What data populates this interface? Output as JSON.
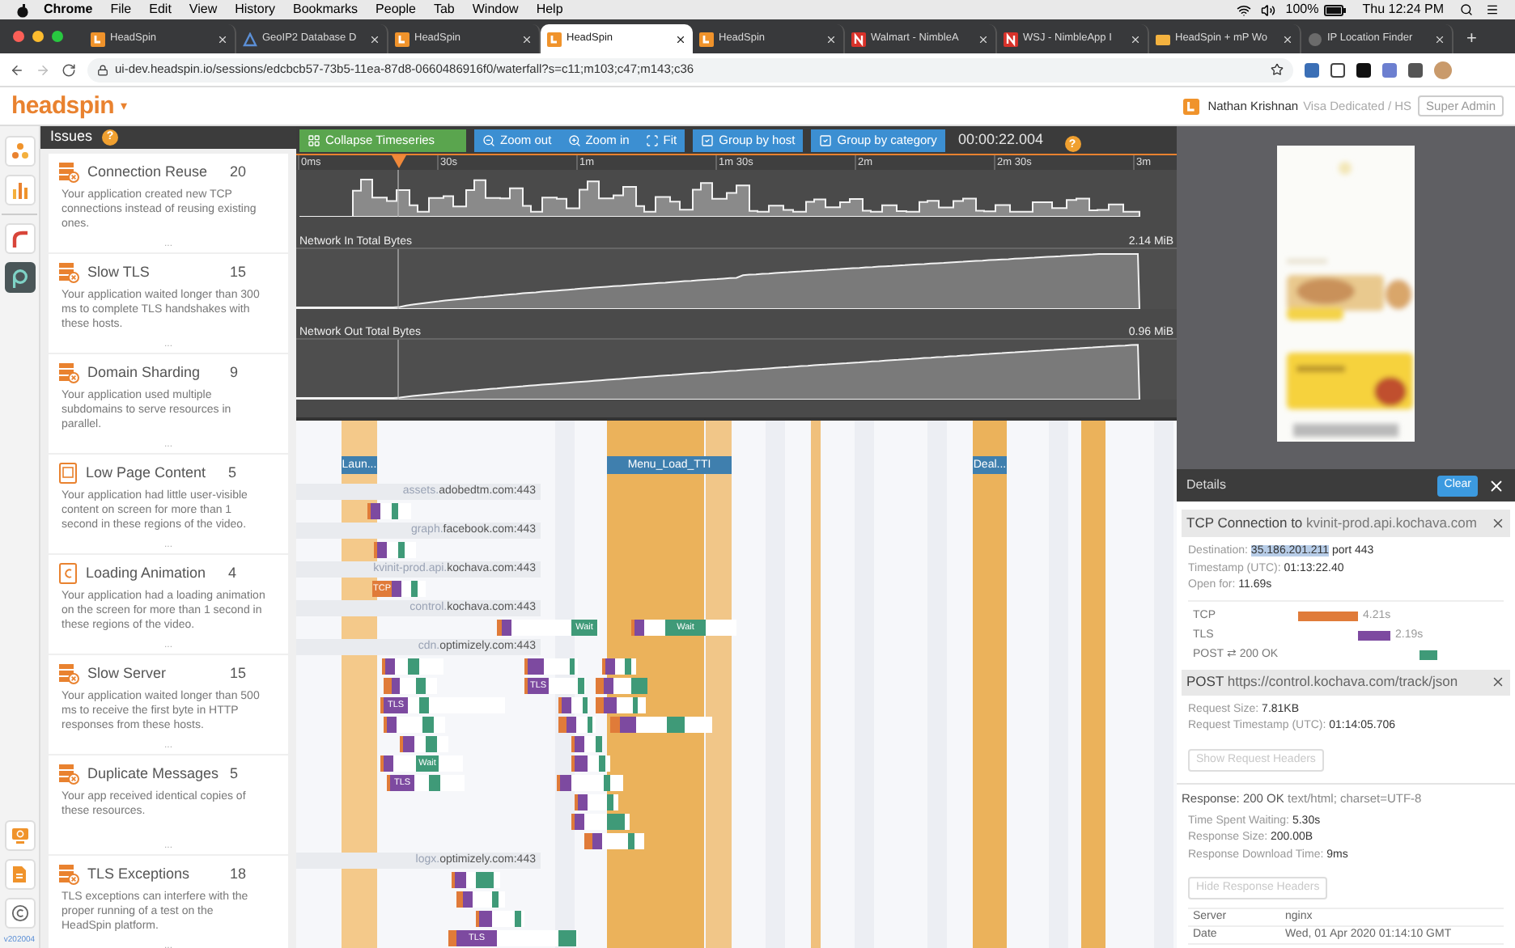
{
  "menu_bar": {
    "app": "Chrome",
    "menus": [
      "File",
      "Edit",
      "View",
      "History",
      "Bookmarks",
      "People",
      "Tab",
      "Window",
      "Help"
    ],
    "battery": "100%",
    "clock": "Thu 12:24 PM"
  },
  "browser": {
    "tabs": [
      {
        "title": "HeadSpin",
        "kind": "headspin",
        "selected": false
      },
      {
        "title": "GeoIP2 Database D",
        "kind": "geoip",
        "selected": false
      },
      {
        "title": "HeadSpin",
        "kind": "headspin",
        "selected": false
      },
      {
        "title": "HeadSpin",
        "kind": "headspin",
        "selected": true
      },
      {
        "title": "HeadSpin",
        "kind": "headspin",
        "selected": false
      },
      {
        "title": "Walmart - NimbleA",
        "kind": "nimble",
        "selected": false
      },
      {
        "title": "WSJ - NimbleApp I",
        "kind": "nimble",
        "selected": false
      },
      {
        "title": "HeadSpin + mP Wo",
        "kind": "folder",
        "selected": false
      },
      {
        "title": "IP Location Finder",
        "kind": "globe",
        "selected": false
      }
    ],
    "new_tab": "+",
    "url": "ui-dev.headspin.io/sessions/edcbcb57-73b5-11ea-87d8-0660486916f0/waterfall?s=c11;m103;c47;m143;c36"
  },
  "app_header": {
    "logo": "headspin",
    "logo_caret": "▾",
    "user": "Nathan Krishnan",
    "org": "Visa Dedicated / HS",
    "role_button": "Super Admin"
  },
  "rail": {
    "top": [
      {
        "kind": "nodes",
        "selected": false
      },
      {
        "kind": "chart",
        "selected": false
      },
      {
        "kind": "curve",
        "selected": false
      },
      {
        "kind": "logo",
        "selected": true
      }
    ],
    "bottom": [
      {
        "kind": "screen",
        "selected": false
      },
      {
        "kind": "document",
        "selected": false
      },
      {
        "kind": "copyright",
        "selected": false
      }
    ],
    "version": "v202004"
  },
  "issues": {
    "title": "Issues",
    "help": "?",
    "items": [
      {
        "kind": "server",
        "title": "Connection Reuse",
        "count": "20",
        "description": "Your application created new TCP connections instead of reusing existing ones.",
        "more": "..."
      },
      {
        "kind": "server",
        "title": "Slow TLS",
        "count": "15",
        "description": "Your application waited longer than 300 ms to complete TLS handshakes with these hosts.",
        "more": "..."
      },
      {
        "kind": "server",
        "title": "Domain Sharding",
        "count": "9",
        "description": "Your application used multiple subdomains to serve resources in parallel.",
        "more": "..."
      },
      {
        "kind": "page",
        "title": "Low Page Content",
        "count": "5",
        "description": "Your application had little user-visible content on screen for more than 1 second in these regions of the video.",
        "more": "..."
      },
      {
        "kind": "animation",
        "title": "Loading Animation",
        "count": "4",
        "description": "Your application had a loading animation on the screen for more than 1 second in these regions of the video.",
        "more": "..."
      },
      {
        "kind": "server",
        "title": "Slow Server",
        "count": "15",
        "description": "Your application waited longer than 500 ms to receive the first byte in HTTP responses from these hosts.",
        "more": "..."
      },
      {
        "kind": "server",
        "title": "Duplicate Messages",
        "count": "5",
        "description": "Your app received identical copies of these resources.",
        "more": "..."
      },
      {
        "kind": "server",
        "title": "TLS Exceptions",
        "count": "18",
        "description": "TLS exceptions can interfere with the proper running of a test on the HeadSpin platform.",
        "more": "..."
      }
    ]
  },
  "timeline": {
    "toolbar": {
      "collapse": "Collapse Timeseries",
      "zoom_out": "Zoom out",
      "zoom_in": "Zoom in",
      "fit": "Fit",
      "groups": [
        {
          "label": "Group by host",
          "checked": true
        },
        {
          "label": "Group by category",
          "checked": true
        }
      ],
      "time": "00:00:22.004",
      "help": "?"
    },
    "ticks": [
      "0ms",
      "30s",
      "1m",
      "1m 30s",
      "2m",
      "2m 30s",
      "3m"
    ],
    "charts": [
      {
        "title": "Network In Total Bytes",
        "max": "2.14 MiB"
      },
      {
        "title": "Network Out Total Bytes",
        "max": "0.96 MiB"
      }
    ],
    "markers": [
      {
        "label": "Laun..."
      },
      {
        "label": "Menu_Load_TTI"
      },
      {
        "label": "Deal..."
      }
    ],
    "hosts": [
      {
        "subdomain": "assets.",
        "domain": "adobedtm.com:443",
        "bars": [
          {
            "kind": "plain"
          }
        ]
      },
      {
        "subdomain": "graph.",
        "domain": "facebook.com:443",
        "bars": [
          {
            "kind": "plain"
          }
        ]
      },
      {
        "subdomain": "kvinit-prod.api.",
        "domain": "kochava.com:443",
        "bars": [
          {
            "kind": "tcp",
            "label": "TCP"
          }
        ]
      },
      {
        "subdomain": "control.",
        "domain": "kochava.com:443",
        "bars": [
          {
            "kind": "wait",
            "label": "Wait"
          },
          {
            "kind": "wait",
            "label": "Wait"
          }
        ]
      },
      {
        "subdomain": "cdn.",
        "domain": "optimizely.com:443",
        "bars": [
          {
            "kind": "plain"
          },
          {
            "kind": "plain"
          },
          {
            "kind": "plain"
          },
          {
            "kind": "plain"
          },
          {
            "kind": "tls",
            "label": "TLS"
          },
          {
            "kind": "plain"
          },
          {
            "kind": "tls",
            "label": "TLS"
          },
          {
            "kind": "plain"
          },
          {
            "kind": "plain"
          },
          {
            "kind": "plain"
          },
          {
            "kind": "plain"
          },
          {
            "kind": "plain"
          },
          {
            "kind": "plain"
          },
          {
            "kind": "plain"
          },
          {
            "kind": "wait",
            "label": "Wait"
          },
          {
            "kind": "plain"
          },
          {
            "kind": "tls",
            "label": "TLS"
          },
          {
            "kind": "plain"
          },
          {
            "kind": "plain"
          },
          {
            "kind": "plain"
          },
          {
            "kind": "plain"
          }
        ]
      },
      {
        "subdomain": "logx.",
        "domain": "optimizely.com:443",
        "bars": [
          {
            "kind": "plain"
          },
          {
            "kind": "plain"
          },
          {
            "kind": "plain"
          },
          {
            "kind": "tls",
            "label": "TLS"
          }
        ]
      }
    ]
  },
  "details": {
    "title": "Details",
    "clear": "Clear",
    "connection": {
      "title": "TCP Connection to",
      "host": "kvinit-prod.api.kochava.com",
      "fields": [
        {
          "label": "Destination:",
          "value": "35.186.201.211",
          "suffix": "port 443",
          "selected": true
        },
        {
          "label": "Timestamp (UTC):",
          "value": "01:13:22.40"
        },
        {
          "label": "Open for:",
          "value": "11.69s"
        }
      ],
      "timings": [
        {
          "kind": "tcp",
          "label": "TCP",
          "value": "4.21s"
        },
        {
          "kind": "tls",
          "label": "TLS",
          "value": "2.19s"
        },
        {
          "kind": "http",
          "label": "POST ⇄ 200 OK"
        }
      ]
    },
    "request": {
      "method": "POST",
      "url": "https://control.kochava.com/track/json",
      "fields": [
        {
          "label": "Request Size:",
          "value": "7.81KB"
        },
        {
          "label": "Request Timestamp (UTC):",
          "value": "01:14:05.706"
        }
      ],
      "request_button": "Show Request Headers",
      "response": {
        "label": "Response:",
        "value": "200 OK",
        "type": "text/html; charset=UTF-8"
      },
      "response_fields": [
        {
          "label": "Time Spent Waiting:",
          "value": "5.30s"
        },
        {
          "label": "Response Size:",
          "value": "200.00B"
        },
        {
          "label": "Response Download Time:",
          "value": "9ms"
        }
      ],
      "response_button": "Hide Response Headers",
      "headers": [
        {
          "name": "Server",
          "value": "nginx"
        },
        {
          "name": "Date",
          "value": "Wed, 01 Apr 2020 01:14:10 GMT"
        }
      ]
    }
  }
}
